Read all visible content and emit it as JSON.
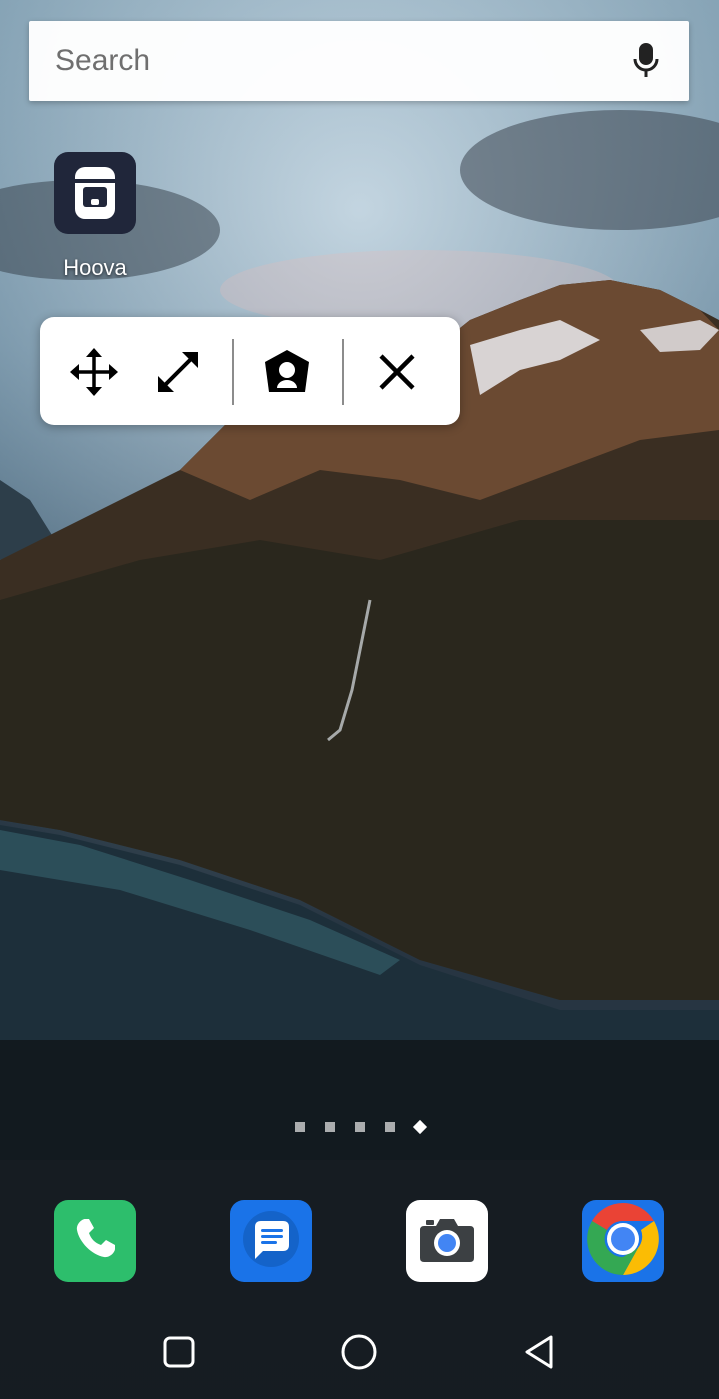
{
  "search": {
    "placeholder": "Search",
    "mic_icon": "microphone-icon"
  },
  "home_apps": [
    {
      "label": "Hoova",
      "icon": "hoova-app-icon",
      "tile_color": "#20263a"
    }
  ],
  "widget_popup": {
    "actions": [
      {
        "icon": "move-icon"
      },
      {
        "icon": "resize-icon"
      },
      {
        "icon": "home-badge-icon"
      },
      {
        "icon": "close-icon"
      }
    ]
  },
  "page_indicator": {
    "count": 5,
    "active_index": 5
  },
  "dock": [
    {
      "name": "phone",
      "icon": "phone-icon",
      "color": "#2dbe6c"
    },
    {
      "name": "messages",
      "icon": "messages-icon",
      "color": "#1a73e8"
    },
    {
      "name": "camera",
      "icon": "camera-icon",
      "color": "#ffffff"
    },
    {
      "name": "chrome",
      "icon": "chrome-icon",
      "color": "#1a73e8"
    }
  ],
  "nav_bar": {
    "buttons": [
      "recents-icon",
      "home-icon",
      "back-icon"
    ]
  }
}
